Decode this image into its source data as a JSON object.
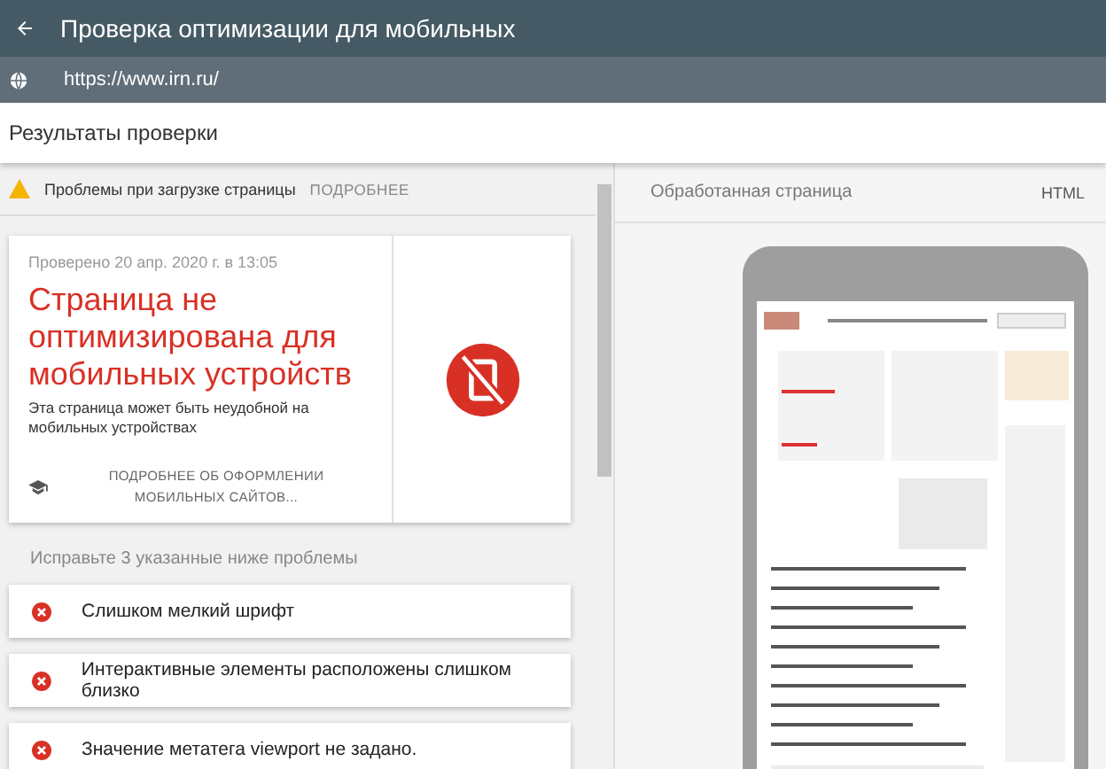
{
  "app_bar": {
    "title": "Проверка оптимизации для мобильных"
  },
  "url_bar": {
    "url": "https://www.irn.ru/"
  },
  "results_title": "Результаты проверки",
  "warning": {
    "text": "Проблемы при загрузке страницы",
    "link": "ПОДРОБНЕЕ"
  },
  "verdict": {
    "checked": "Проверено 20 апр. 2020 г. в 13:05",
    "headline": "Страница не оптимизирована для мобильных устройств",
    "description": "Эта страница может быть неудобной на мобильных устройствах",
    "learn_more": "ПОДРОБНЕЕ ОБ ОФОРМЛЕНИИ МОБИЛЬНЫХ САЙТОВ..."
  },
  "fix_heading": "Исправьте 3 указанные ниже проблемы",
  "issues": [
    {
      "text": "Слишком мелкий шрифт"
    },
    {
      "text": "Интерактивные элементы расположены слишком близко"
    },
    {
      "text": "Значение метатега viewport не задано."
    }
  ],
  "preview": {
    "title": "Обработанная страница",
    "tab": "HTML"
  }
}
